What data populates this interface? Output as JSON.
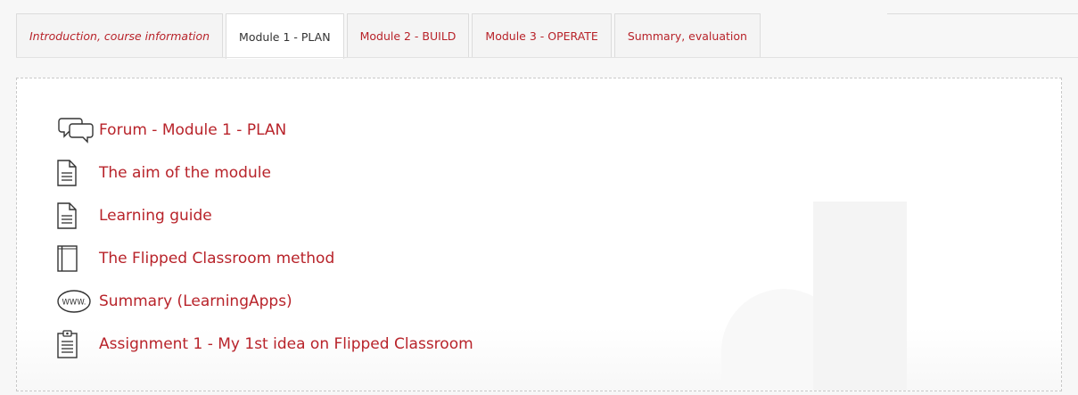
{
  "tabs": [
    {
      "label": "Introduction, course information",
      "active": false,
      "italic": true
    },
    {
      "label": "Module 1 - PLAN",
      "active": true,
      "italic": false
    },
    {
      "label": "Module 2 - BUILD",
      "active": false,
      "italic": false
    },
    {
      "label": "Module 3 - OPERATE",
      "active": false,
      "italic": false
    },
    {
      "label": "Summary, evaluation",
      "active": false,
      "italic": false
    }
  ],
  "activities": [
    {
      "label": "Forum - Module 1 - PLAN",
      "icon": "forum-icon"
    },
    {
      "label": "The aim of the module",
      "icon": "page-icon"
    },
    {
      "label": "Learning guide",
      "icon": "page-icon"
    },
    {
      "label": "The Flipped Classroom method",
      "icon": "book-icon"
    },
    {
      "label": "Summary (LearningApps)",
      "icon": "url-icon"
    },
    {
      "label": "Assignment 1 - My 1st idea on Flipped Classroom",
      "icon": "assignment-icon"
    }
  ],
  "url_icon_text": "WWW.",
  "colors": {
    "link": "#b8232a",
    "active_tab_text": "#333333",
    "background": "#f7f7f7"
  }
}
